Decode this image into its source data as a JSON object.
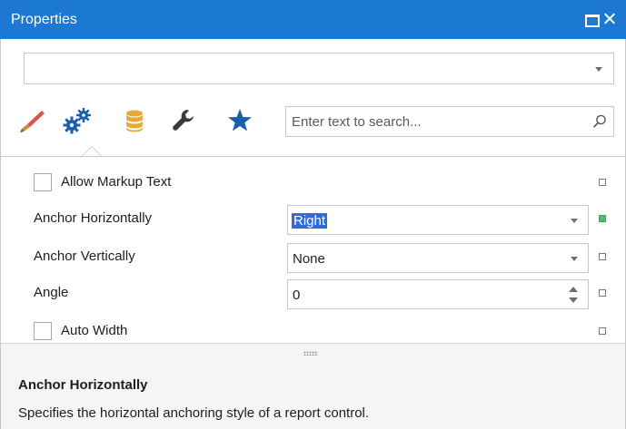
{
  "window": {
    "title": "Properties",
    "buttons": [
      "maximize",
      "close"
    ]
  },
  "selector": {
    "value": ""
  },
  "tabs": [
    {
      "name": "appearance",
      "icon": "brush-icon",
      "color": "#8b5a2b"
    },
    {
      "name": "behavior",
      "icon": "gears-icon",
      "color": "#1b5fae",
      "active": true
    },
    {
      "name": "data",
      "icon": "database-icon",
      "color": "#e8a938"
    },
    {
      "name": "layout",
      "icon": "wrench-icon",
      "color": "#3a3a3a"
    },
    {
      "name": "favorites",
      "icon": "star-icon",
      "color": "#1b5fae"
    }
  ],
  "search": {
    "placeholder": "Enter text to search...",
    "value": ""
  },
  "properties": {
    "allow_markup_text": {
      "label": "Allow Markup Text",
      "checked": false
    },
    "anchor_horizontally": {
      "label": "Anchor Horizontally",
      "value": "Right",
      "modified": true
    },
    "anchor_vertically": {
      "label": "Anchor Vertically",
      "value": "None"
    },
    "angle": {
      "label": "Angle",
      "value": "0"
    },
    "auto_width": {
      "label": "Auto Width",
      "checked": false
    }
  },
  "description": {
    "title": "Anchor Horizontally",
    "text": "Specifies the horizontal anchoring style of a report control."
  },
  "colors": {
    "titlebar": "#1b79d3",
    "selection": "#2d6bd8",
    "modified_marker": "#5cb46f",
    "description_bg": "#f5f5f5"
  }
}
